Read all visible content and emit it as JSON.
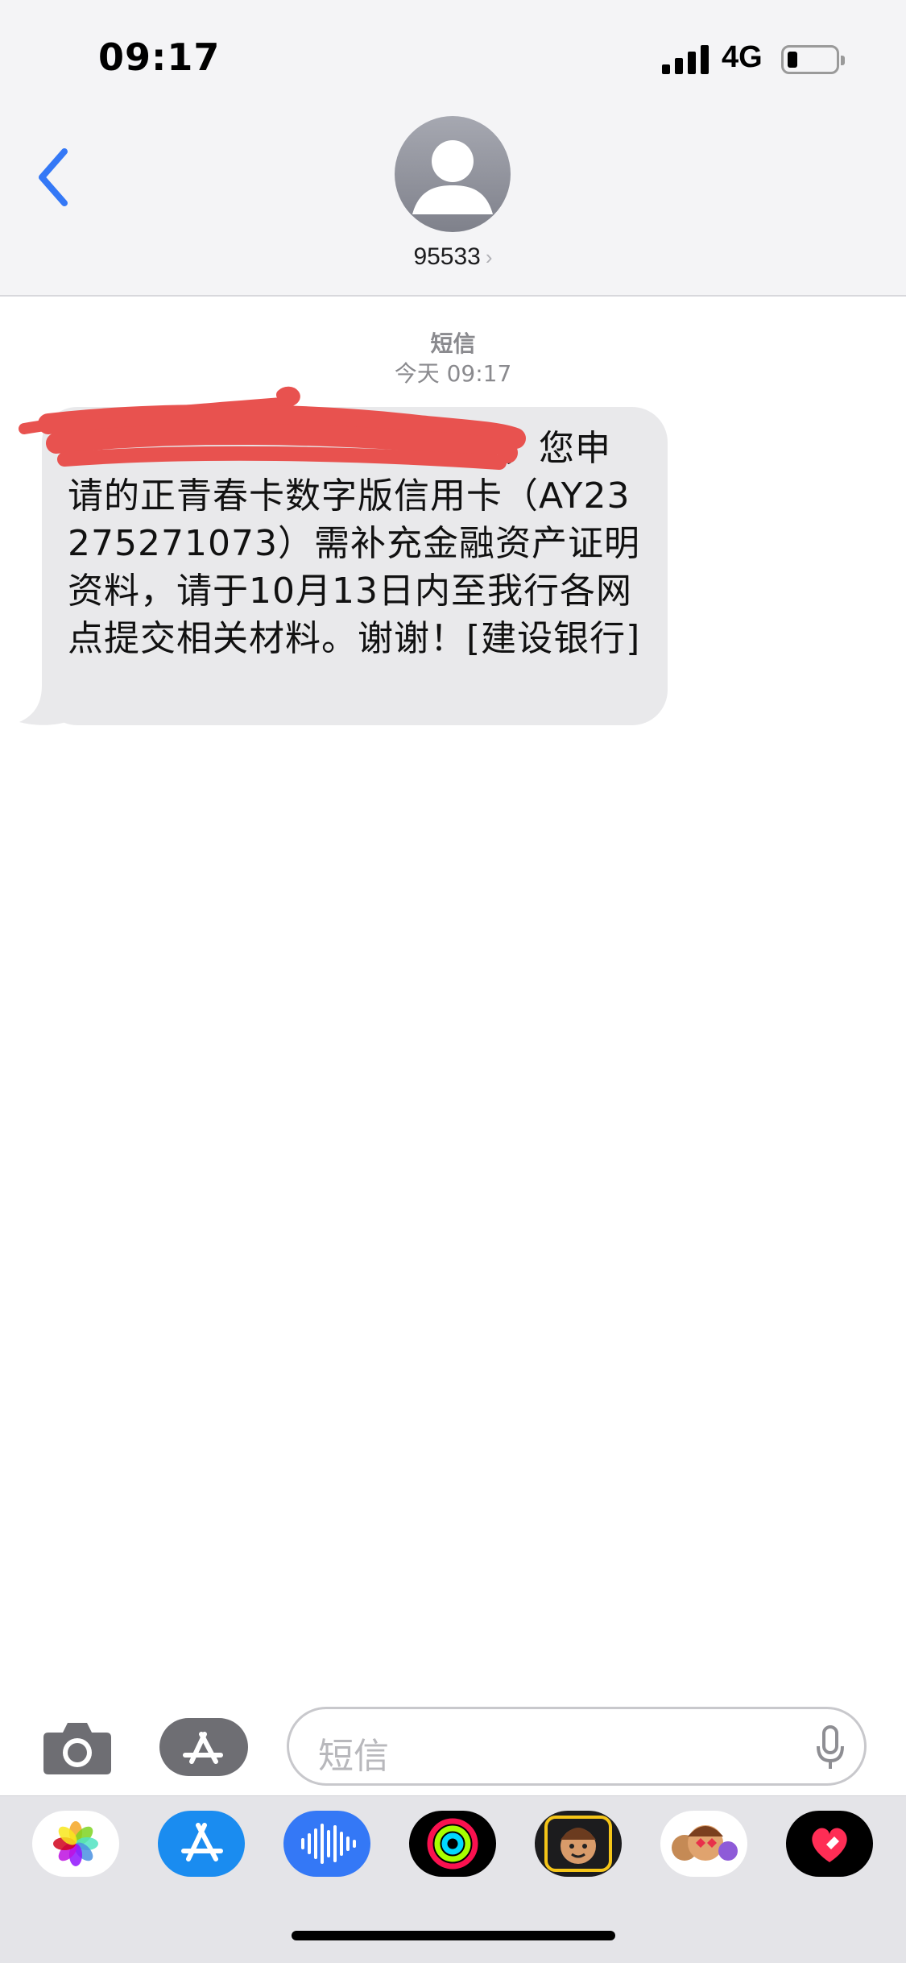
{
  "status_bar": {
    "time": "09:17",
    "network": "4G",
    "battery_level": 0.2
  },
  "header": {
    "back_icon": "chevron-left-icon",
    "avatar_icon": "person-silhouette-icon",
    "contact": "95533",
    "contact_chevron": "›"
  },
  "conversation": {
    "service_label": "短信",
    "timestamp_day": "今天",
    "timestamp_time": "09:17",
    "messages": [
      {
        "direction": "incoming",
        "text": "，您申请的正青春卡数字版信用卡（AY23275271073）需补充金融资产证明资料，请于10月13日内至我行各网点提交相关材料。谢谢！[建设银行]",
        "redacted_prefix": true
      }
    ]
  },
  "input_bar": {
    "placeholder": "短信",
    "camera_icon": "camera-icon",
    "apps_icon": "app-store-icon",
    "mic_icon": "microphone-icon"
  },
  "app_drawer": {
    "apps": [
      {
        "name": "photos-app-icon"
      },
      {
        "name": "app-store-app-icon"
      },
      {
        "name": "audio-message-app-icon"
      },
      {
        "name": "activity-app-icon"
      },
      {
        "name": "memoji-app-icon"
      },
      {
        "name": "memoji-stickers-app-icon"
      },
      {
        "name": "digital-touch-app-icon"
      }
    ]
  },
  "colors": {
    "accent": "#3478f6",
    "bubble": "#e9e9eb",
    "redaction": "#e8524f"
  }
}
